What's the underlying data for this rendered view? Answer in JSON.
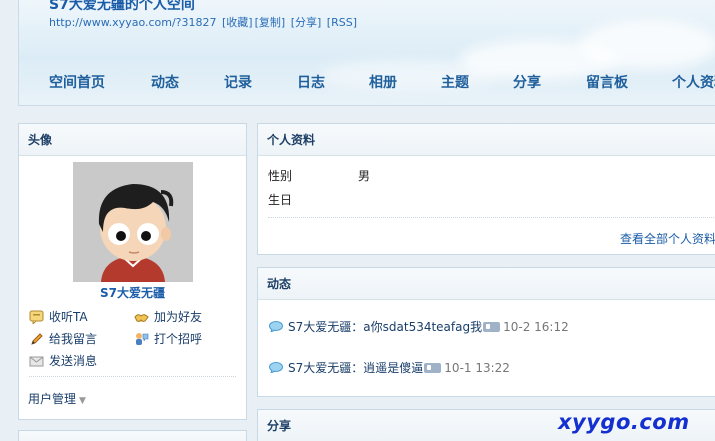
{
  "header": {
    "title": "S7大爱无疆的个人空间",
    "url": "http://www.xyyao.com/?31827",
    "links": [
      "[收藏]",
      "[复制]",
      "[分享]",
      "[RSS]"
    ]
  },
  "nav": [
    "空间首页",
    "动态",
    "记录",
    "日志",
    "相册",
    "主题",
    "分享",
    "留言板",
    "个人资料"
  ],
  "avatar_panel": {
    "title": "头像",
    "username": "S7大爱无疆",
    "actions": [
      "收听TA",
      "加为好友",
      "给我留言",
      "打个招呼",
      "发送消息"
    ],
    "management": "用户管理"
  },
  "profile_panel": {
    "title": "个人资料",
    "fields": [
      {
        "label": "性别",
        "value": "男"
      },
      {
        "label": "生日",
        "value": ""
      }
    ],
    "more_link": "查看全部个人资料"
  },
  "feed_panel": {
    "title": "动态",
    "items": [
      {
        "user": "S7大爱无疆",
        "sep": "：",
        "text": "a你sdat534teafag我",
        "time": "10-2 16:12"
      },
      {
        "user": "S7大爱无疆",
        "sep": "：",
        "text": "逍遥是傻逼",
        "time": "10-1 13:22"
      }
    ]
  },
  "share_panel": {
    "title": "分享"
  },
  "watermark": "xyygo.com",
  "colors": {
    "link": "#1a5ca8",
    "nav": "#1f5f9c",
    "watermark": "#1530d0",
    "background": "#e9f0f5"
  }
}
